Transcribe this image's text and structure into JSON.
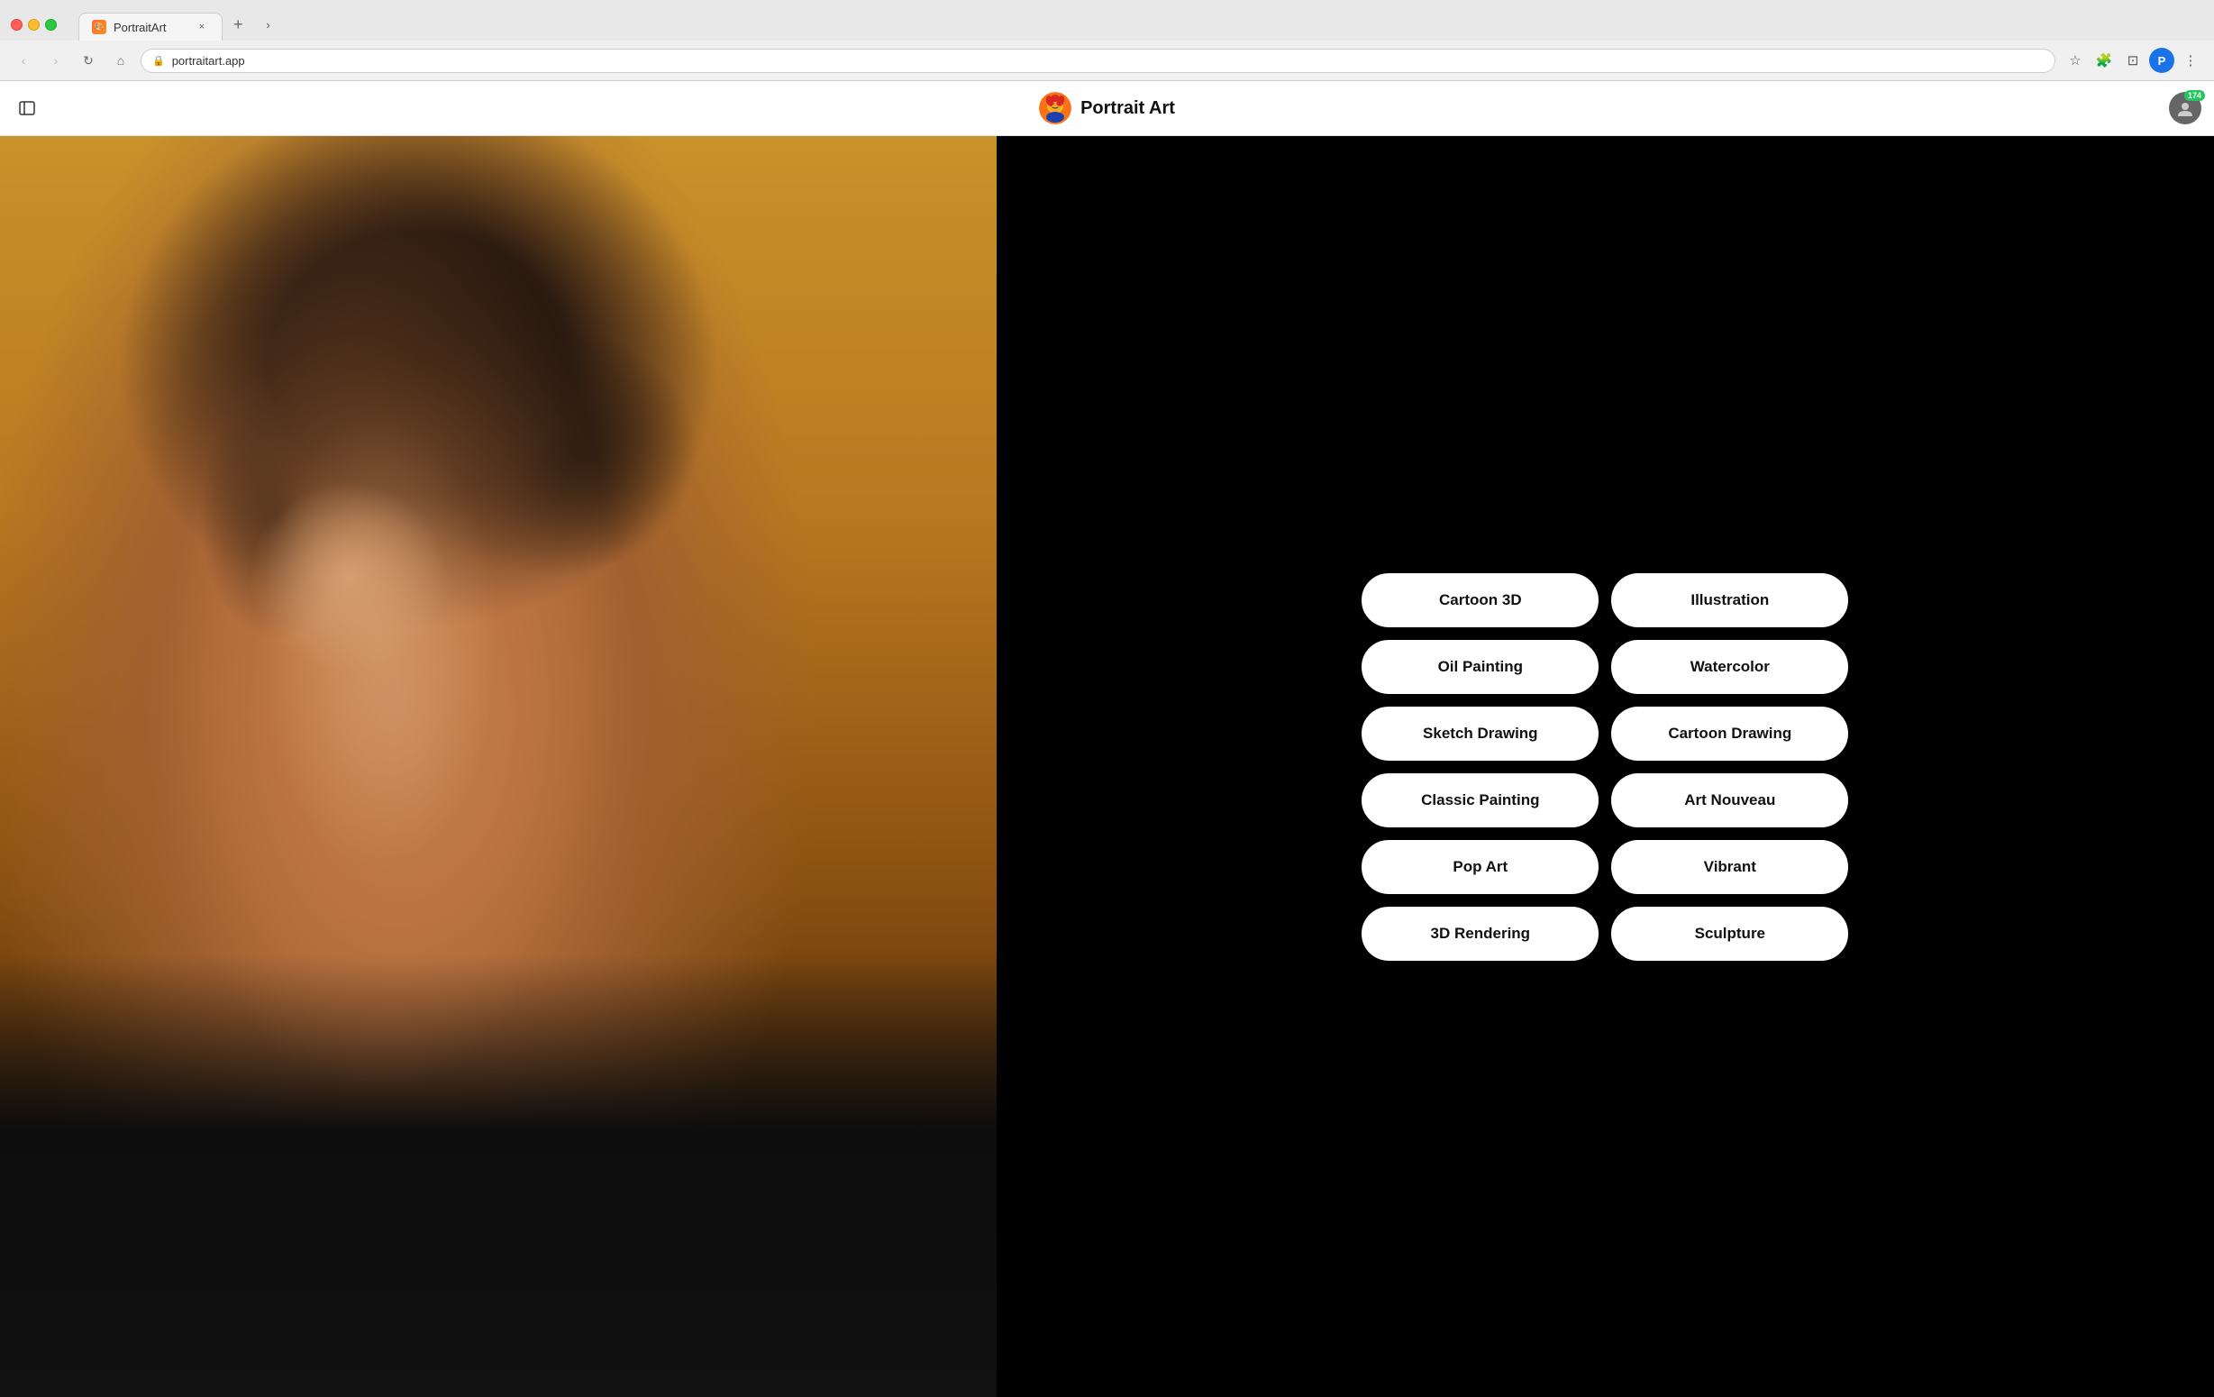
{
  "browser": {
    "tab_title": "PortraitArt",
    "url": "portraitart.app",
    "new_tab_label": "+",
    "close_tab_label": "×",
    "nav": {
      "back_icon": "←",
      "forward_icon": "→",
      "reload_icon": "↻",
      "home_icon": "⌂",
      "star_icon": "☆",
      "extensions_icon": "🧩",
      "sidebar_icon": "⊡",
      "profile_label": "P",
      "more_icon": "⋮"
    }
  },
  "app": {
    "title": "Portrait Art",
    "sidebar_toggle_icon": "sidebar-icon",
    "user_badge_count": "174",
    "avatar_icon": "user-avatar-icon"
  },
  "style_buttons": [
    {
      "id": "cartoon-3d",
      "label": "Cartoon 3D"
    },
    {
      "id": "illustration",
      "label": "Illustration"
    },
    {
      "id": "oil-painting",
      "label": "Oil Painting"
    },
    {
      "id": "watercolor",
      "label": "Watercolor"
    },
    {
      "id": "sketch-drawing",
      "label": "Sketch Drawing"
    },
    {
      "id": "cartoon-drawing",
      "label": "Cartoon Drawing"
    },
    {
      "id": "classic-painting",
      "label": "Classic Painting"
    },
    {
      "id": "art-nouveau",
      "label": "Art Nouveau"
    },
    {
      "id": "pop-art",
      "label": "Pop Art"
    },
    {
      "id": "vibrant",
      "label": "Vibrant"
    },
    {
      "id": "3d-rendering",
      "label": "3D Rendering"
    },
    {
      "id": "sculpture",
      "label": "Sculpture"
    }
  ],
  "colors": {
    "bg_dark": "#000000",
    "bg_light": "#ffffff",
    "btn_bg": "#ffffff",
    "btn_text": "#111111",
    "accent": "#22c55e"
  }
}
